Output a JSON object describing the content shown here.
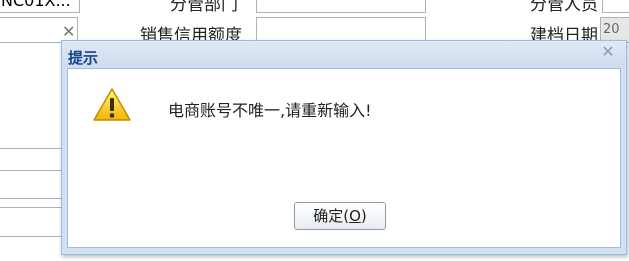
{
  "background": {
    "top_left_field_value": "NC01X...",
    "dept_label": "分管部门",
    "manager_label": "分管人员",
    "credit_label": "销售信用额度",
    "date_label": "建档日期",
    "date_value": "20"
  },
  "dialog": {
    "title": "提示",
    "message": "电商账号不唯一,请重新输入!",
    "ok_label": "确定",
    "ok_mnemonic_open": "(",
    "ok_mnemonic_key": "O",
    "ok_mnemonic_close": ")"
  },
  "colors": {
    "dialog_frame": "#d3e1f1",
    "dialog_title": "#15428b",
    "warning_icon": "#f5c518"
  }
}
